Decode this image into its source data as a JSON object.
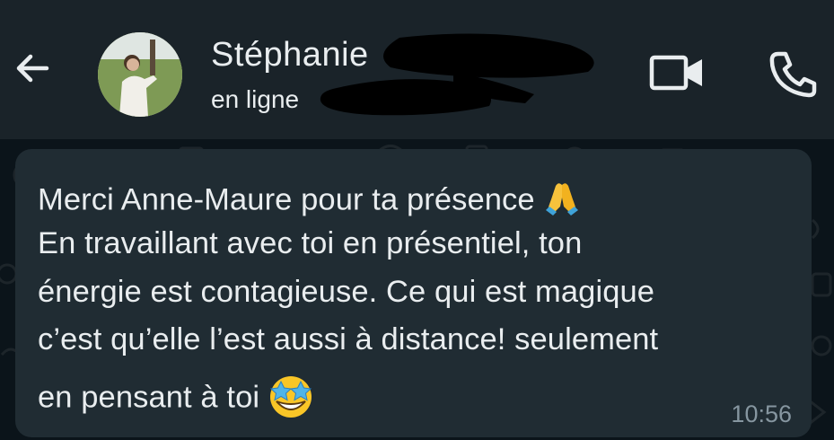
{
  "header": {
    "back_icon": "arrow-left-icon",
    "contact_name": "Stéphanie",
    "contact_status": "en ligne",
    "video_icon": "video-camera-icon",
    "call_icon": "phone-icon"
  },
  "message": {
    "lines": [
      "Merci Anne-Maure pour ta présence",
      "En travaillant avec toi en présentiel, ton",
      "énergie est contagieuse. Ce qui est magique",
      "c’est qu’elle l’est aussi à distance! seulement",
      "en pensant à toi"
    ],
    "emoji_1": "folded-hands-icon",
    "emoji_2": "star-struck-icon",
    "time": "10:56"
  },
  "colors": {
    "background": "#0b141a",
    "header": "#1a2329",
    "bubble": "#202c33",
    "text": "#e9edef",
    "timestamp": "#8696a0"
  }
}
